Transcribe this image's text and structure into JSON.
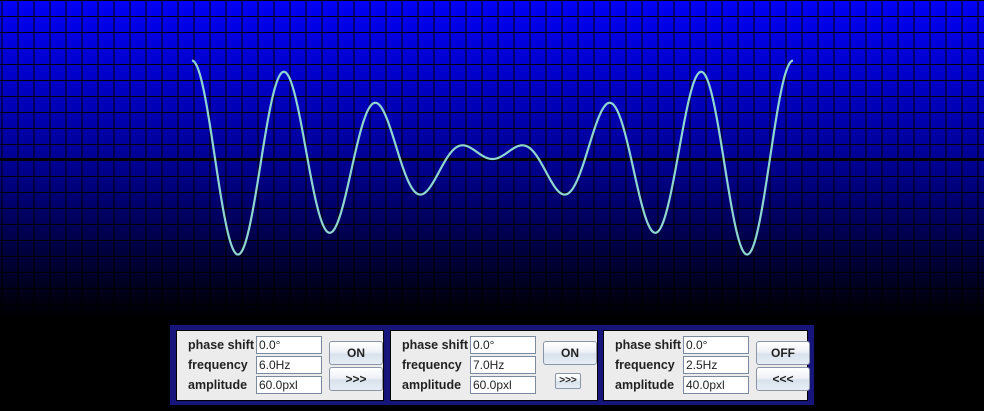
{
  "colors": {
    "grid": "#000000",
    "axis": "#000000",
    "wave": "#8fd6cf"
  },
  "waves": [
    {
      "phase_label": "phase shift",
      "phase_value": "0.0°",
      "frequency_label": "frequency",
      "frequency_value": "6.0Hz",
      "amplitude_label": "amplitude",
      "amplitude_value": "60.0pxl",
      "toggle_label": "ON",
      "direction_label": ">>>"
    },
    {
      "phase_label": "phase shift",
      "phase_value": "0.0°",
      "frequency_label": "frequency",
      "frequency_value": "7.0Hz",
      "amplitude_label": "amplitude",
      "amplitude_value": "60.0pxl",
      "toggle_label": "ON",
      "direction_label": ">>>"
    },
    {
      "phase_label": "phase shift",
      "phase_value": "0.0°",
      "frequency_label": "frequency",
      "frequency_value": "2.5Hz",
      "amplitude_label": "amplitude",
      "amplitude_value": "40.0pxl",
      "toggle_label": "OFF",
      "direction_label": "<<<"
    }
  ],
  "signal": {
    "sum": [
      {
        "f": 6.0,
        "a": 60.0,
        "on": true
      },
      {
        "f": 7.0,
        "a": 60.0,
        "on": true
      }
    ]
  }
}
